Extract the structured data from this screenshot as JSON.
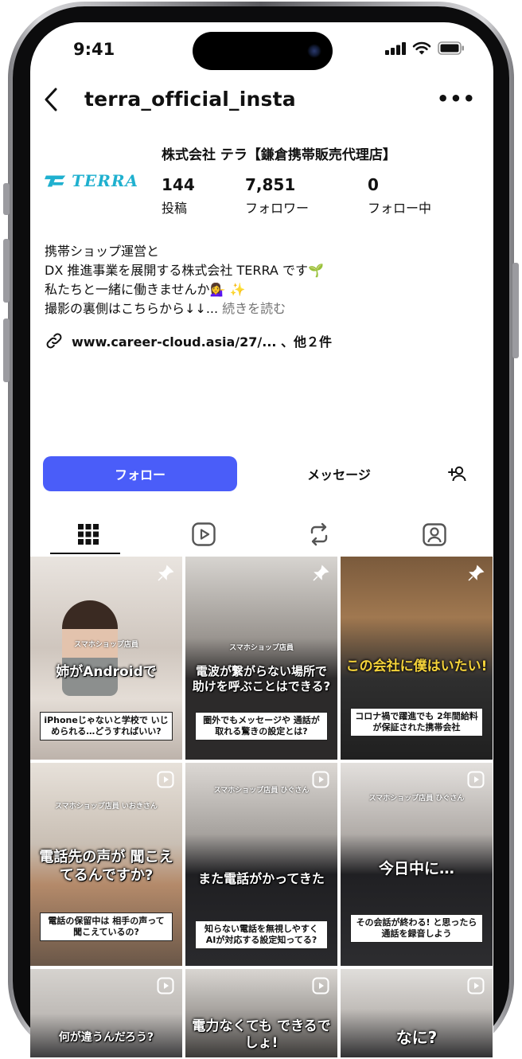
{
  "status_bar": {
    "time": "9:41"
  },
  "header": {
    "username": "terra_official_insta",
    "more": "•••"
  },
  "profile": {
    "logo_text": "TERRA",
    "name": "株式会社 テラ【鎌倉携帯販売代理店】",
    "stats": [
      {
        "value": "144",
        "label": "投稿"
      },
      {
        "value": "7,851",
        "label": "フォロワー"
      },
      {
        "value": "0",
        "label": "フォロー中"
      }
    ],
    "bio": {
      "line1": "携帯ショップ運営と",
      "line2": "DX 推進事業を展開する株式会社 TERRA です🌱",
      "line3": "私たちと一緒に働きませんか💁‍♀️ ✨",
      "line4": "撮影の裏側はこちらから↓↓...",
      "more": "続きを読む"
    },
    "link": "www.career-cloud.asia/27/...  、他２件"
  },
  "actions": {
    "follow": "フォロー",
    "message": "メッセージ"
  },
  "tabs": [
    "posts-grid",
    "reels",
    "reposts",
    "tagged"
  ],
  "posts": [
    {
      "name_tag": "スマホショップ店員",
      "main": "姉がAndroidで",
      "caption": "iPhoneじゃないと学校で いじめられる…どうすればいい?",
      "badge": "pin"
    },
    {
      "name_tag": "スマホショップ店員",
      "main": "電波が繋がらない場所で 助けを呼ぶことはできる?",
      "caption": "圏外でもメッセージや 通話が取れる驚きの設定とは?",
      "badge": "pin"
    },
    {
      "name_tag": "",
      "main": "この会社に僕はいたい!",
      "caption": "コロナ禍で躍進でも 2年間給料が保証された携帯会社",
      "badge": "pin"
    },
    {
      "name_tag": "スマホショップ店員 いおきさん",
      "main": "電話先の声が 聞こえてるんですか?",
      "caption": "電話の保留中は 相手の声って聞こえているの?",
      "badge": "reel"
    },
    {
      "name_tag": "スマホショップ店員 ひぐさん",
      "main": "また電話がかってきた",
      "caption": "知らない電話を無視しやすく AIが対応する設定知ってる?",
      "badge": "reel"
    },
    {
      "name_tag": "スマホショップ店員 ひぐさん",
      "main": "今日中に…",
      "caption": "その会話が終わる! と思ったら通話を録音しよう",
      "badge": "reel"
    },
    {
      "name_tag": "",
      "main": "何が違うんだろう?",
      "caption": "",
      "badge": "reel"
    },
    {
      "name_tag": "",
      "main": "電力なくても できるでしょ!",
      "caption": "",
      "badge": "reel"
    },
    {
      "name_tag": "",
      "main": "なに?",
      "caption": "",
      "badge": "reel"
    }
  ],
  "colors": {
    "follow_button": "#4a5df9",
    "logo": "#1fb0cf"
  }
}
